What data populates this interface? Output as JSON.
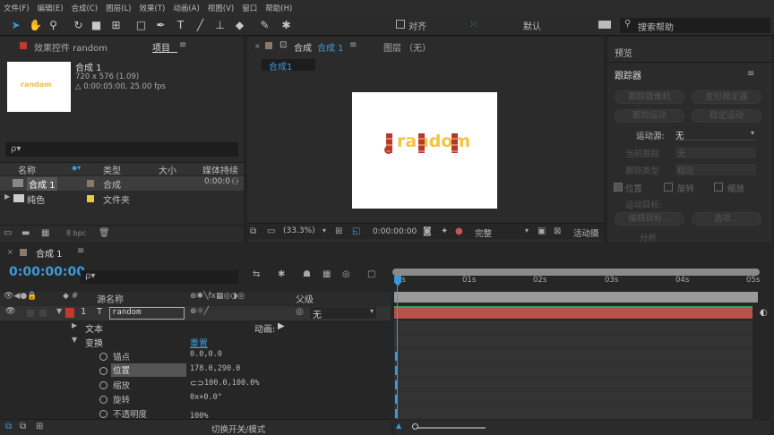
{
  "menu": [
    "文件(F)",
    "编辑(E)",
    "合成(C)",
    "图层(L)",
    "效果(T)",
    "动画(A)",
    "视图(V)",
    "窗口",
    "帮助(H)"
  ],
  "toolbar": {
    "align_label": "对齐",
    "workspace": "默认",
    "search_placeholder": "搜索帮助"
  },
  "project": {
    "effects_tab": "效果控件 random",
    "project_tab": "项目",
    "comp_name": "合成 1",
    "comp_dims": "720 x 576 (1.09)",
    "comp_duration": "△ 0:00:05:00, 25.00 fps",
    "thumb_text": "random",
    "search_icon_text": "ρ▾",
    "headers": {
      "name": "名称",
      "type": "类型",
      "size": "大小",
      "duration": "媒体持续"
    },
    "items": [
      {
        "name": "合成 1",
        "type": "合成",
        "duration": "0:00:0"
      },
      {
        "name": "纯色",
        "type": "文件夹",
        "duration": ""
      }
    ],
    "bpc": "8 bpc"
  },
  "viewer": {
    "tab": "合成",
    "tab_comp": "合成 1",
    "layer_tab": "图层 （无）",
    "crumb": "合成1",
    "text": "random",
    "zoom": "(33.3%)",
    "timecode": "0:00:00:00",
    "quality": "完整",
    "active_cam": "活动摄"
  },
  "right": {
    "preview": "预览",
    "tracker": "跟踪器",
    "track_cam": "跟踪摄像机",
    "stabilize": "变形稳定器",
    "track_motion": "跟踪运动",
    "stabilize_motion": "稳定运动",
    "motion_source_label": "运动源:",
    "motion_source": "无",
    "current_track_label": "当前跟踪",
    "current_track": "无",
    "track_type_label": "跟踪类型",
    "track_type": "稳定",
    "pos": "位置",
    "rot": "旋转",
    "scale": "缩放",
    "target_label": "运动目标:",
    "edit_target": "编辑目标...",
    "options": "选项...",
    "analyze": "分析"
  },
  "timeline": {
    "tab": "合成 1",
    "timecode": "0:00:00:00",
    "search": "ρ▾",
    "col_source": "源名称",
    "col_parent": "父级",
    "layer_num": "1",
    "layer_type": "T",
    "layer_name": "random",
    "parent_value": "无",
    "text_group": "文本",
    "animate_label": "动画:",
    "transform": "变换",
    "reset": "重置",
    "props": [
      {
        "name": "锚点",
        "value": "0.0,0.0"
      },
      {
        "name": "位置",
        "value": "178.0,290.0"
      },
      {
        "name": "缩放",
        "value": "100.0,100.0%"
      },
      {
        "name": "旋转",
        "value": "0x+0.0°"
      },
      {
        "name": "不透明度",
        "value": "100%"
      }
    ],
    "ruler": [
      "0s",
      "01s",
      "02s",
      "03s",
      "04s",
      "05s"
    ],
    "toggle_label": "切换开关/模式"
  }
}
